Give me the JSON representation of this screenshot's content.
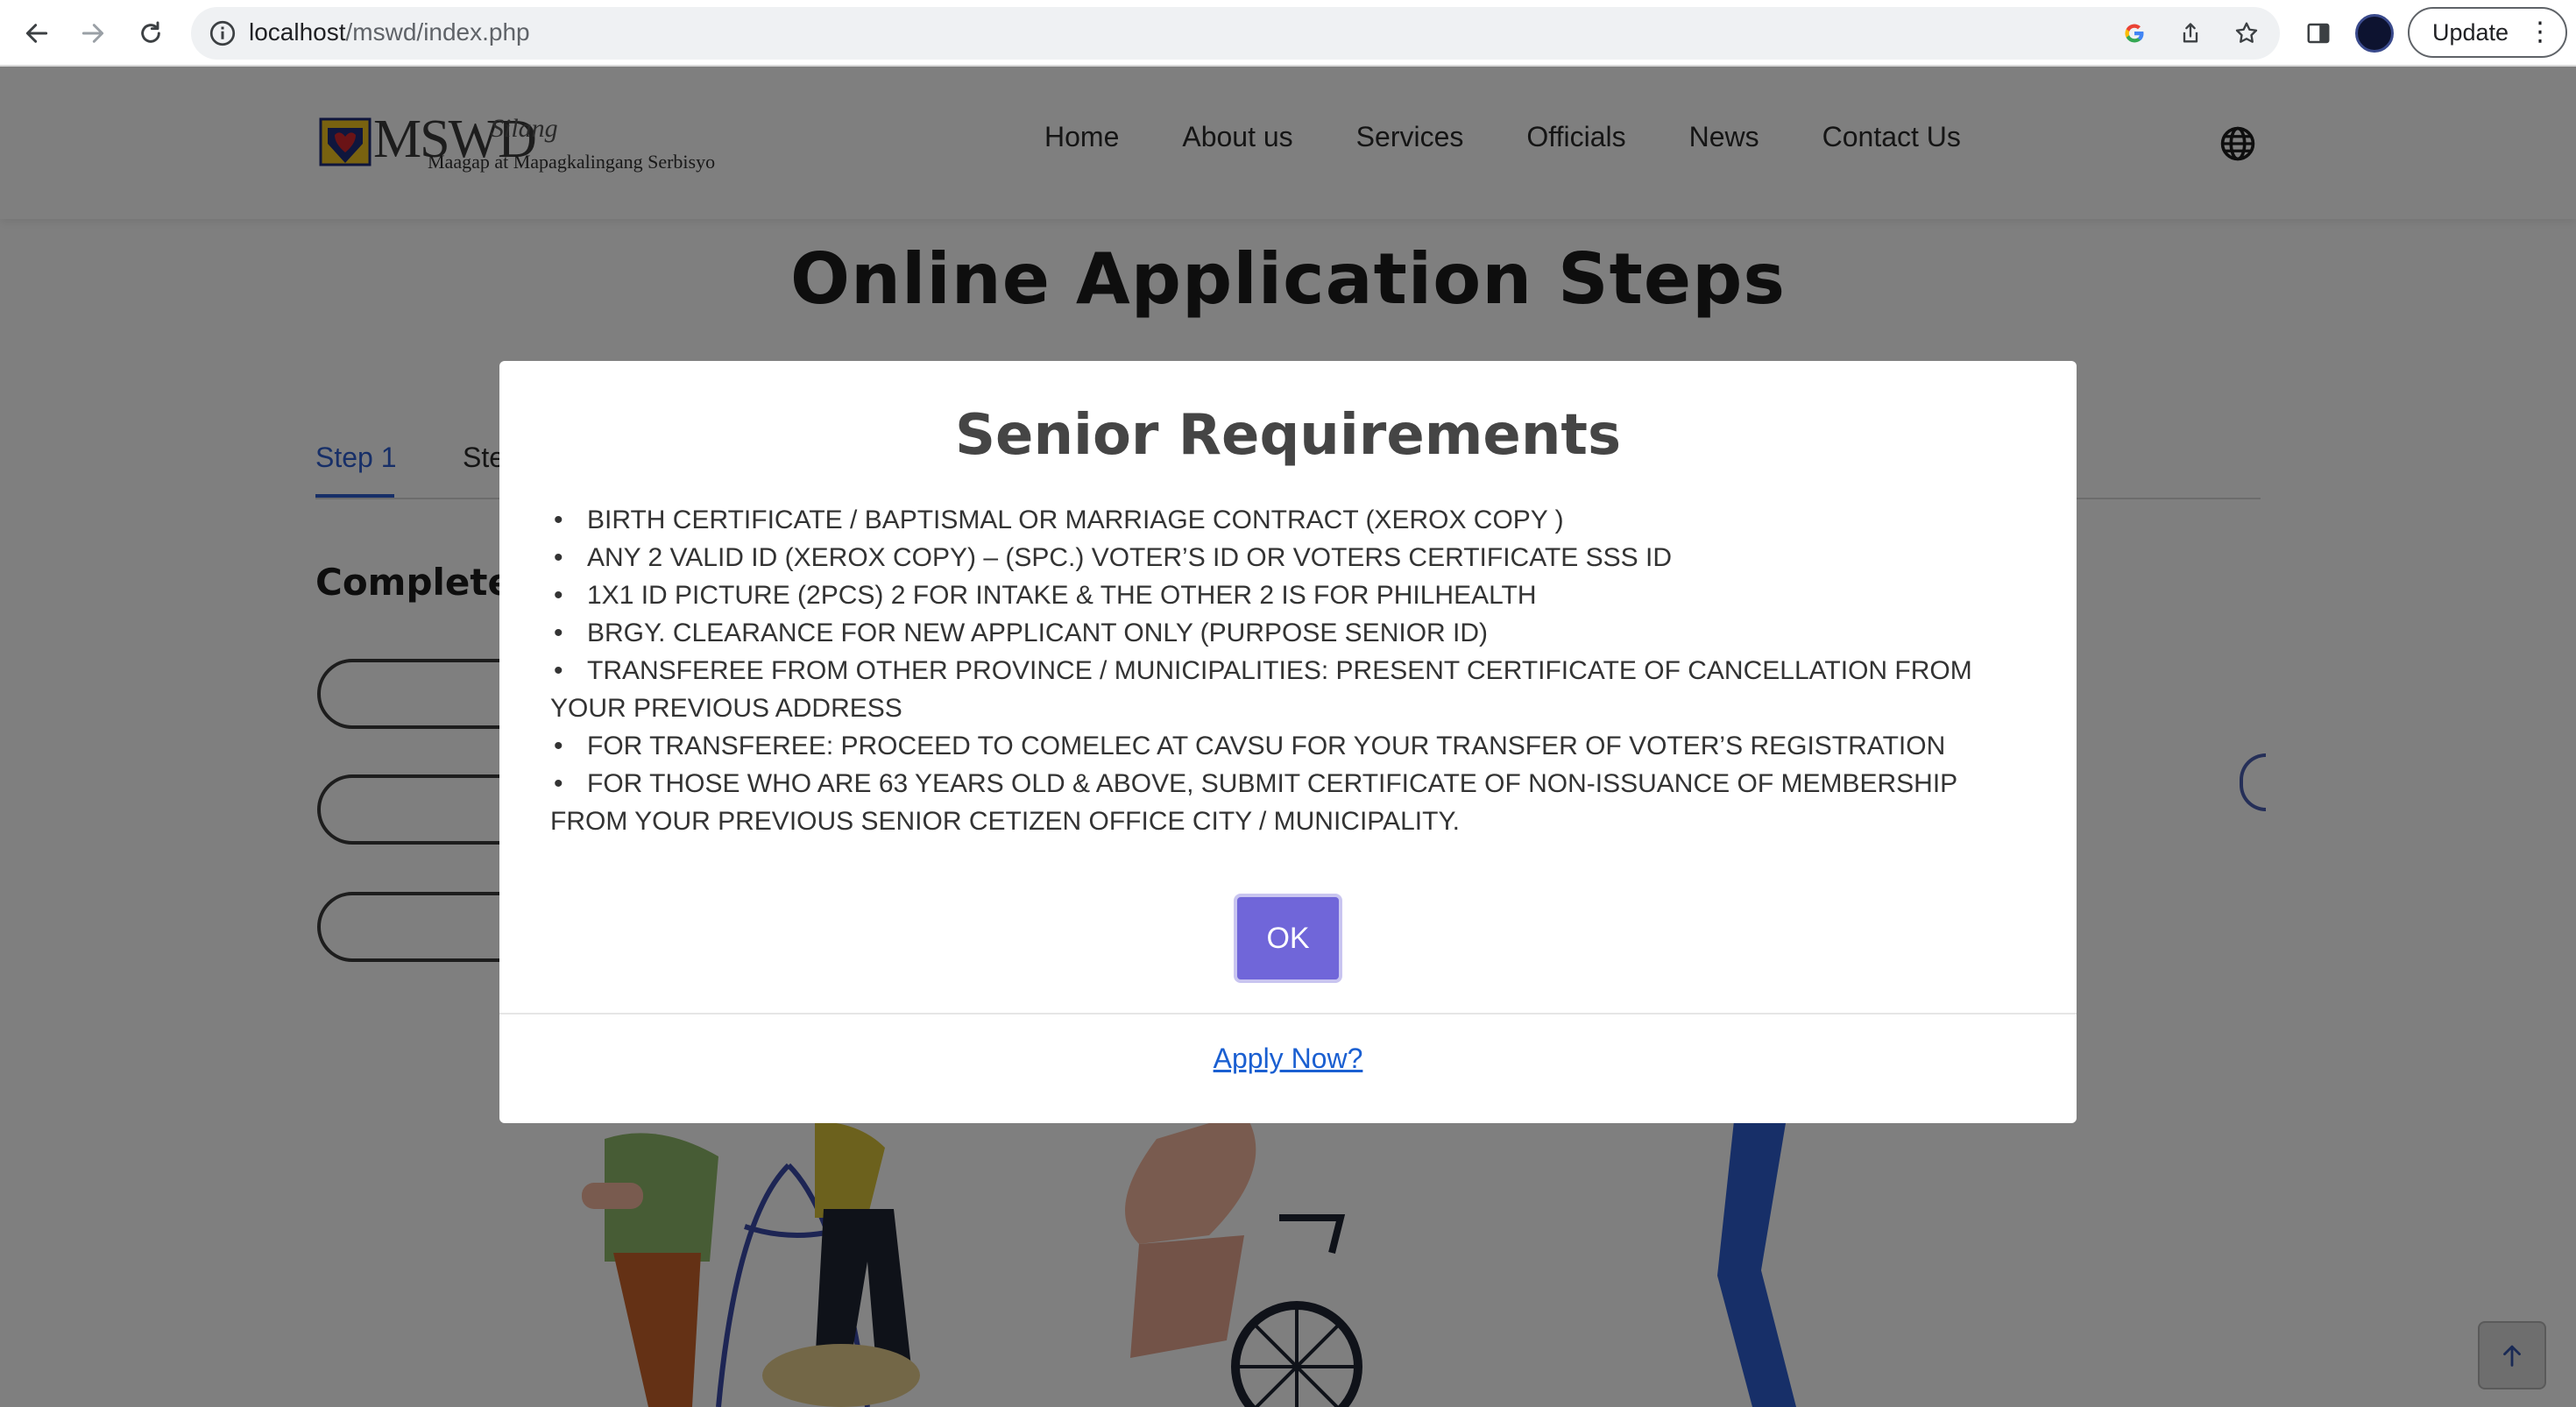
{
  "browser": {
    "url_host": "localhost",
    "url_path": "/mswd/index.php",
    "update_label": "Update",
    "menu_label": "⋮"
  },
  "header": {
    "logo_main": "MSWD",
    "logo_script": "Silang",
    "logo_tagline": "Maagap at Mapagkalingang Serbisyo",
    "nav": {
      "home": "Home",
      "about": "About us",
      "services": "Services",
      "officials": "Officials",
      "news": "News",
      "contact": "Contact Us"
    }
  },
  "page": {
    "title": "Online Application Steps",
    "tab_1": "Step 1",
    "tab_2": "Ste",
    "section_heading": "Complete"
  },
  "modal": {
    "title": "Senior Requirements",
    "requirements": [
      "BIRTH CERTIFICATE / BAPTISMAL OR MARRIAGE CONTRACT (XEROX COPY )",
      "ANY 2 VALID ID (XEROX COPY) – (SPC.) VOTER’S ID OR VOTERS CERTIFICATE SSS ID",
      "1X1 ID PICTURE (2PCS) 2 FOR INTAKE & THE OTHER 2 IS FOR PHILHEALTH",
      "BRGY. CLEARANCE FOR NEW APPLICANT ONLY (PURPOSE SENIOR ID)",
      "TRANSFEREE FROM OTHER PROVINCE / MUNICIPALITIES: PRESENT CERTIFICATE OF CANCELLATION FROM YOUR PREVIOUS ADDRESS",
      "FOR TRANSFEREE: PROCEED TO COMELEC AT CAVSU FOR YOUR TRANSFER OF VOTER’S REGISTRATION",
      "FOR THOSE WHO ARE 63 YEARS OLD & ABOVE, SUBMIT CERTIFICATE OF NON-ISSUANCE OF MEMBERSHIP FROM YOUR PREVIOUS SENIOR CETIZEN OFFICE CITY / MUNICIPALITY."
    ],
    "ok_label": "OK",
    "apply_link": "Apply Now?"
  },
  "colors": {
    "accent": "#7066d9",
    "link": "#1a5fd1",
    "tab_active": "#2f5fd0",
    "overlay": "rgba(0,0,0,0.5)"
  },
  "icons": {
    "back": "arrow-left-icon",
    "forward": "arrow-right-icon",
    "reload": "reload-icon",
    "info": "info-icon",
    "google": "google-icon",
    "share": "share-icon",
    "bookmark": "star-icon",
    "sidepanel": "side-panel-icon",
    "globe": "globe-icon",
    "scroll_top": "arrow-up-icon"
  }
}
